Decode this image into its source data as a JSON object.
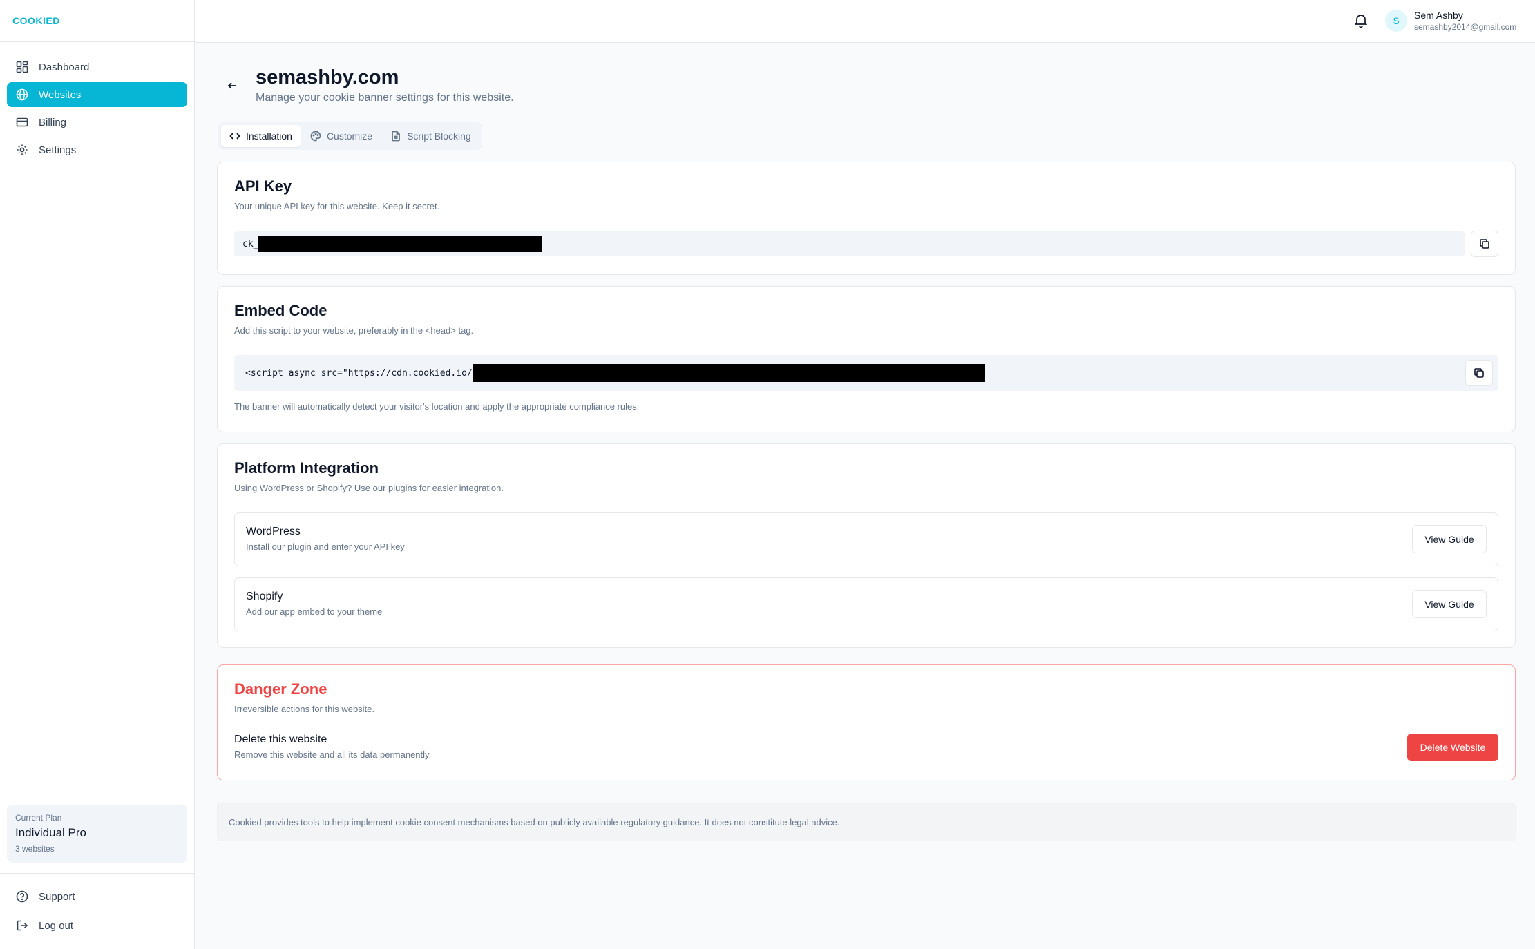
{
  "app": {
    "logo": "COOKIED",
    "accent": "#06b6d4",
    "danger": "#ef4444"
  },
  "sidebar": {
    "items": [
      {
        "label": "Dashboard",
        "icon": "grid-icon"
      },
      {
        "label": "Websites",
        "icon": "globe-icon",
        "active": true
      },
      {
        "label": "Billing",
        "icon": "credit-card-icon"
      },
      {
        "label": "Settings",
        "icon": "gear-icon"
      }
    ],
    "plan": {
      "label": "Current Plan",
      "name": "Individual Pro",
      "sub": "3 websites"
    },
    "bottom": [
      {
        "label": "Support",
        "icon": "help-circle-icon"
      },
      {
        "label": "Log out",
        "icon": "logout-icon"
      }
    ]
  },
  "topbar": {
    "avatar_initial": "S",
    "user_name": "Sem Ashby",
    "user_email": "semashby2014@gmail.com"
  },
  "page": {
    "title": "semashby.com",
    "subtitle": "Manage your cookie banner settings for this website.",
    "tabs": [
      {
        "label": "Installation",
        "icon": "code-icon",
        "active": true
      },
      {
        "label": "Customize",
        "icon": "palette-icon"
      },
      {
        "label": "Script Blocking",
        "icon": "file-icon"
      }
    ]
  },
  "api_key": {
    "title": "API Key",
    "description": "Your unique API key for this website. Keep it secret.",
    "value_prefix": "ck_"
  },
  "embed": {
    "title": "Embed Code",
    "description": "Add this script to your website, preferably in the <head> tag.",
    "code_prefix": "<script async src=\"https://cdn.cookied.io/",
    "note": "The banner will automatically detect your visitor's location and apply the appropriate compliance rules."
  },
  "platform": {
    "title": "Platform Integration",
    "description": "Using WordPress or Shopify? Use our plugins for easier integration.",
    "items": [
      {
        "name": "WordPress",
        "desc": "Install our plugin and enter your API key",
        "button": "View Guide"
      },
      {
        "name": "Shopify",
        "desc": "Add our app embed to your theme",
        "button": "View Guide"
      }
    ]
  },
  "danger": {
    "title": "Danger Zone",
    "description": "Irreversible actions for this website.",
    "delete_title": "Delete this website",
    "delete_desc": "Remove this website and all its data permanently.",
    "delete_button": "Delete Website"
  },
  "disclaimer": "Cookied provides tools to help implement cookie consent mechanisms based on publicly available regulatory guidance. It does not constitute legal advice."
}
